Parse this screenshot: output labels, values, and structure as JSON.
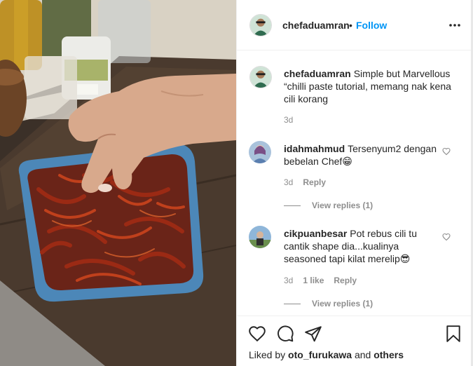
{
  "post": {
    "author": "chefaduamran",
    "dot": "•",
    "follow_label": "Follow",
    "more_icon": "more-horizontal-icon"
  },
  "caption": {
    "username": "chefaduamran",
    "text": "Simple but Marvellous “chilli paste tutorial, memang nak kena cili korang",
    "time": "3d"
  },
  "comments": [
    {
      "username": "idahmahmud",
      "text": "Tersenyum2 dengan bebelan Chef",
      "emoji": "😁",
      "time": "3d",
      "likes": "",
      "reply_label": "Reply",
      "view_replies": "View replies (1)"
    },
    {
      "username": "cikpuanbesar",
      "text": "Pot rebus cili tu cantik shape dia...kualinya seasoned tapi kilat merelip",
      "emoji": "😎",
      "time": "3d",
      "likes": "1 like",
      "reply_label": "Reply",
      "view_replies": "View replies (1)"
    }
  ],
  "actions": {
    "icons": [
      "heart-icon",
      "comment-icon",
      "share-icon",
      "bookmark-icon"
    ],
    "liked_by_prefix": "Liked by",
    "liked_by_user": "oto_furukawa",
    "liked_by_and": "and",
    "liked_by_others": "others"
  },
  "colors": {
    "accent": "#0095f6",
    "secondary_text": "#8e8e8e",
    "primary_text": "#262626",
    "border": "#efefef"
  }
}
